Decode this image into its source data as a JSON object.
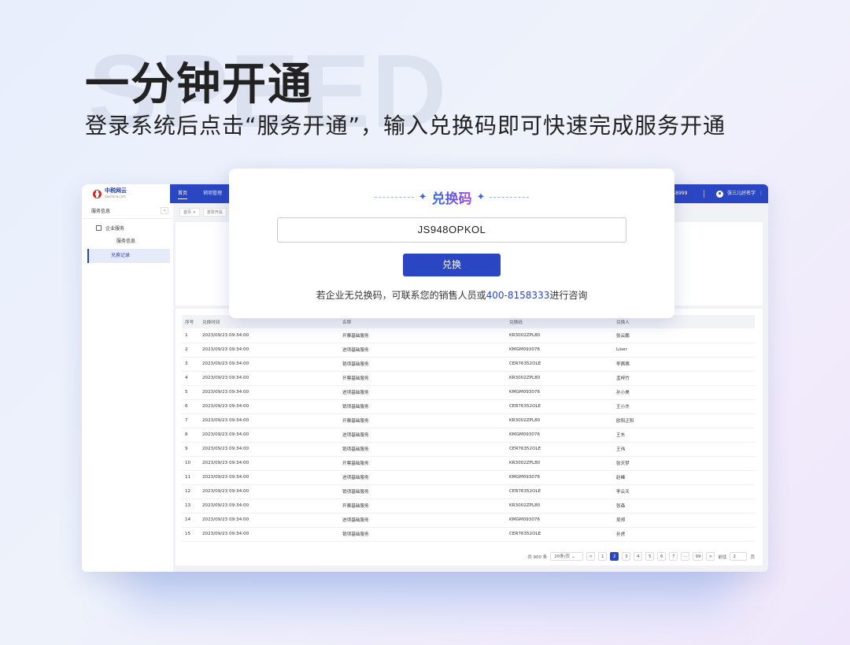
{
  "hero": {
    "bg_word": "SPEED",
    "title": "一分钟开通",
    "subtitle": "登录系统后点击“服务开通”，输入兑换码即可快速完成服务开通"
  },
  "app": {
    "logo": {
      "name": "中税网云",
      "domain": "taxchina.com"
    },
    "nav": [
      "首页",
      "销项管理"
    ],
    "phone": "-8999",
    "user": "张三儿好名字",
    "sidebar": {
      "title": "服务信息",
      "collapse": "«",
      "group": "企业服务",
      "items": [
        "服务信息",
        "兑换记录"
      ]
    },
    "breadcrumbs": [
      "首页 ×",
      "发票开具"
    ],
    "table": {
      "headers": [
        "序号",
        "兑换时间",
        "名称",
        "兑换码",
        "兑换人"
      ],
      "rows": [
        [
          "1",
          "2023/09/23  09:34:00",
          "开票基础服务",
          "KR3002ZPL80",
          "张云鹏"
        ],
        [
          "2",
          "2023/09/23  09:34:00",
          "进项基础服务",
          "KMGM093076",
          "Lioer"
        ],
        [
          "3",
          "2023/09/23  09:34:00",
          "销项基础服务",
          "CER76352OLE",
          "李茜茜"
        ],
        [
          "4",
          "2023/09/23  09:34:00",
          "开票基础服务",
          "KR3002ZPL80",
          "孟梓竹"
        ],
        [
          "5",
          "2023/09/23  09:34:00",
          "进项基础服务",
          "KMGM093076",
          "孙小美"
        ],
        [
          "6",
          "2023/09/23  09:34:00",
          "销项基础服务",
          "CER76352OLE",
          "王小杰"
        ],
        [
          "7",
          "2023/09/23  09:34:00",
          "开票基础服务",
          "KR3002ZPL80",
          "欧阳正阳"
        ],
        [
          "8",
          "2023/09/23  09:34:00",
          "进项基础服务",
          "KMGM093076",
          "王东"
        ],
        [
          "9",
          "2023/09/23  09:34:00",
          "销项基础服务",
          "CER76352OLE",
          "王伟"
        ],
        [
          "10",
          "2023/09/23  09:34:00",
          "开票基础服务",
          "KR3002ZPL80",
          "张天梦"
        ],
        [
          "11",
          "2023/09/23  09:34:00",
          "进项基础服务",
          "KMGM093076",
          "赵峰"
        ],
        [
          "12",
          "2023/09/23  09:34:00",
          "销项基础服务",
          "CER76352OLE",
          "李云天"
        ],
        [
          "13",
          "2023/09/23  09:34:00",
          "开票基础服务",
          "KR3002ZPL80",
          "张森"
        ],
        [
          "14",
          "2023/09/23  09:34:00",
          "进项基础服务",
          "KMGM093076",
          "吴郑"
        ],
        [
          "15",
          "2023/09/23  09:34:00",
          "销项基础服务",
          "CER76352OLE",
          "孙虎"
        ]
      ]
    },
    "pagination": {
      "total": "共 900 条",
      "page_size": "20条/页",
      "prev": "<",
      "pages": [
        "1",
        "2",
        "3",
        "4",
        "5",
        "6",
        "7",
        "···",
        "99"
      ],
      "current": "2",
      "next": ">",
      "goto_label": "前往",
      "goto_value": "2",
      "goto_suffix": "页"
    }
  },
  "modal": {
    "title": "兑换码",
    "code": "JS948OPKOL",
    "button": "兑换",
    "note_prefix": "若企业无兑换码，可联系您的销售人员或",
    "note_phone": "400-8158333",
    "note_suffix": "进行咨询"
  },
  "colors": {
    "primary": "#2b46c2",
    "accent": "#3a5fe8"
  }
}
